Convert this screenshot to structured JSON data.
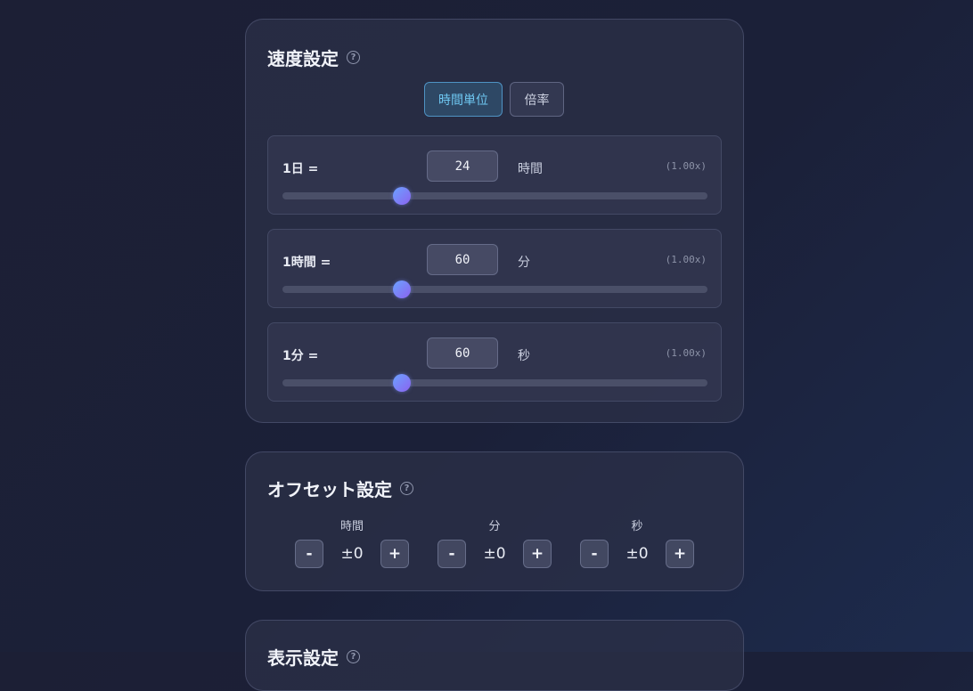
{
  "speed": {
    "title": "速度設定",
    "help_symbol": "?",
    "tabs": [
      {
        "label": "時間単位",
        "active": true
      },
      {
        "label": "倍率",
        "active": false
      }
    ],
    "rows": [
      {
        "label": "1日 =",
        "value": "24",
        "unit": "時間",
        "multiplier": "(1.00x)",
        "slider_fraction": 0.28
      },
      {
        "label": "1時間 =",
        "value": "60",
        "unit": "分",
        "multiplier": "(1.00x)",
        "slider_fraction": 0.28
      },
      {
        "label": "1分 =",
        "value": "60",
        "unit": "秒",
        "multiplier": "(1.00x)",
        "slider_fraction": 0.28
      }
    ]
  },
  "offset": {
    "title": "オフセット設定",
    "help_symbol": "?",
    "groups": [
      {
        "label": "時間",
        "value": "±0",
        "minus": "-",
        "plus": "+"
      },
      {
        "label": "分",
        "value": "±0",
        "minus": "-",
        "plus": "+"
      },
      {
        "label": "秒",
        "value": "±0",
        "minus": "-",
        "plus": "+"
      }
    ]
  },
  "display": {
    "title": "表示設定",
    "help_symbol": "?"
  },
  "colors": {
    "accent": "#6fc8f2",
    "slider_thumb": "#7a86f6"
  }
}
